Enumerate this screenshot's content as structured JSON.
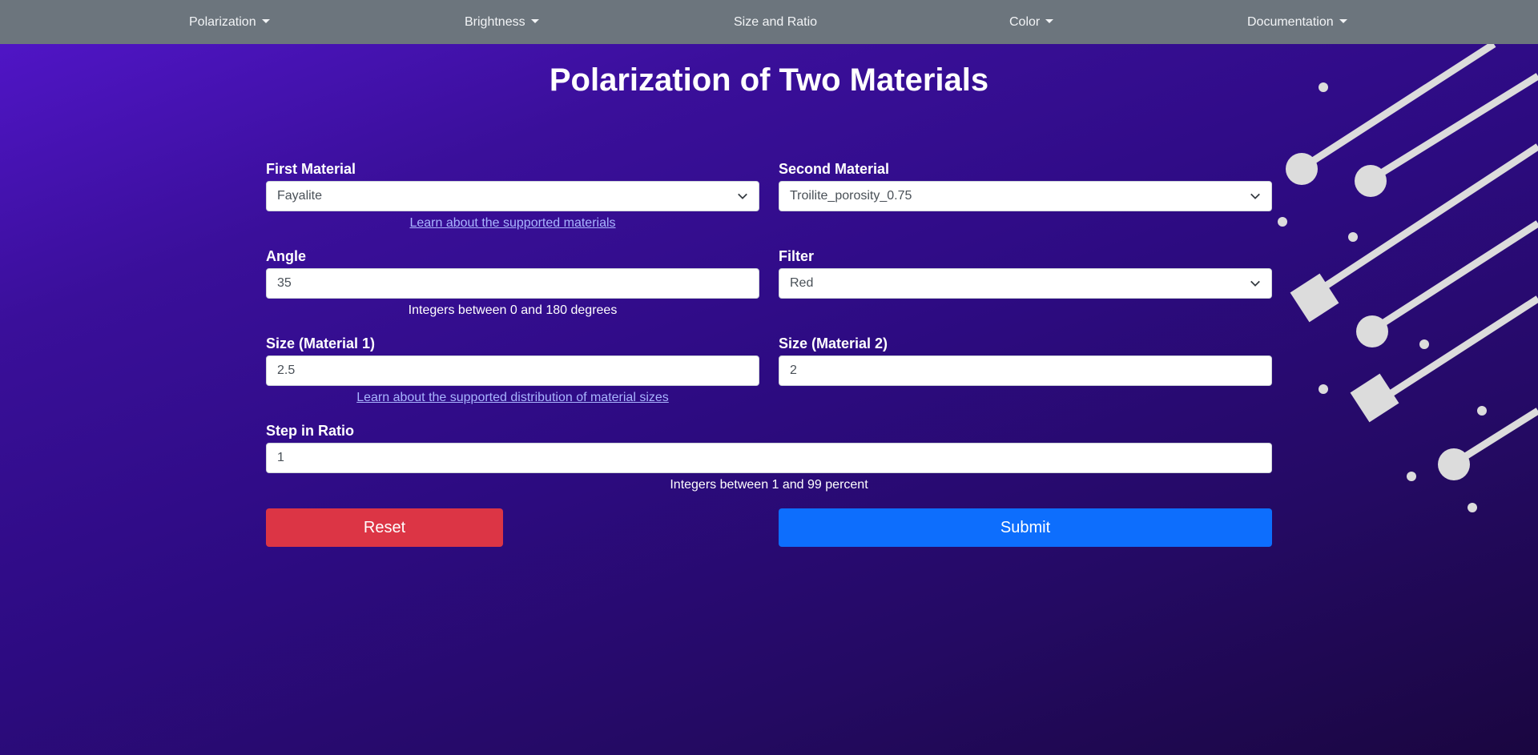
{
  "nav": {
    "items": [
      {
        "label": "Polarization",
        "dropdown": true
      },
      {
        "label": "Brightness",
        "dropdown": true
      },
      {
        "label": "Size and Ratio",
        "dropdown": false
      },
      {
        "label": "Color",
        "dropdown": true
      },
      {
        "label": "Documentation",
        "dropdown": true
      }
    ]
  },
  "page": {
    "title": "Polarization of Two Materials"
  },
  "form": {
    "first_material": {
      "label": "First Material",
      "value": "Fayalite"
    },
    "second_material": {
      "label": "Second Material",
      "value": "Troilite_porosity_0.75"
    },
    "materials_link": "Learn about the supported materials",
    "angle": {
      "label": "Angle",
      "value": "35",
      "help": "Integers between 0 and 180 degrees"
    },
    "filter": {
      "label": "Filter",
      "value": "Red"
    },
    "size1": {
      "label": "Size (Material 1)",
      "value": "2.5"
    },
    "size2": {
      "label": "Size (Material 2)",
      "value": "2"
    },
    "sizes_link": "Learn about the supported distribution of material sizes",
    "step": {
      "label": "Step in Ratio",
      "value": "1",
      "help": "Integers between 1 and 99 percent"
    },
    "reset_label": "Reset",
    "submit_label": "Submit"
  },
  "colors": {
    "navbar": "#6c757d",
    "reset": "#dc3545",
    "submit": "#0d6efd",
    "background_start": "#5316cc",
    "background_end": "#1a0640"
  }
}
